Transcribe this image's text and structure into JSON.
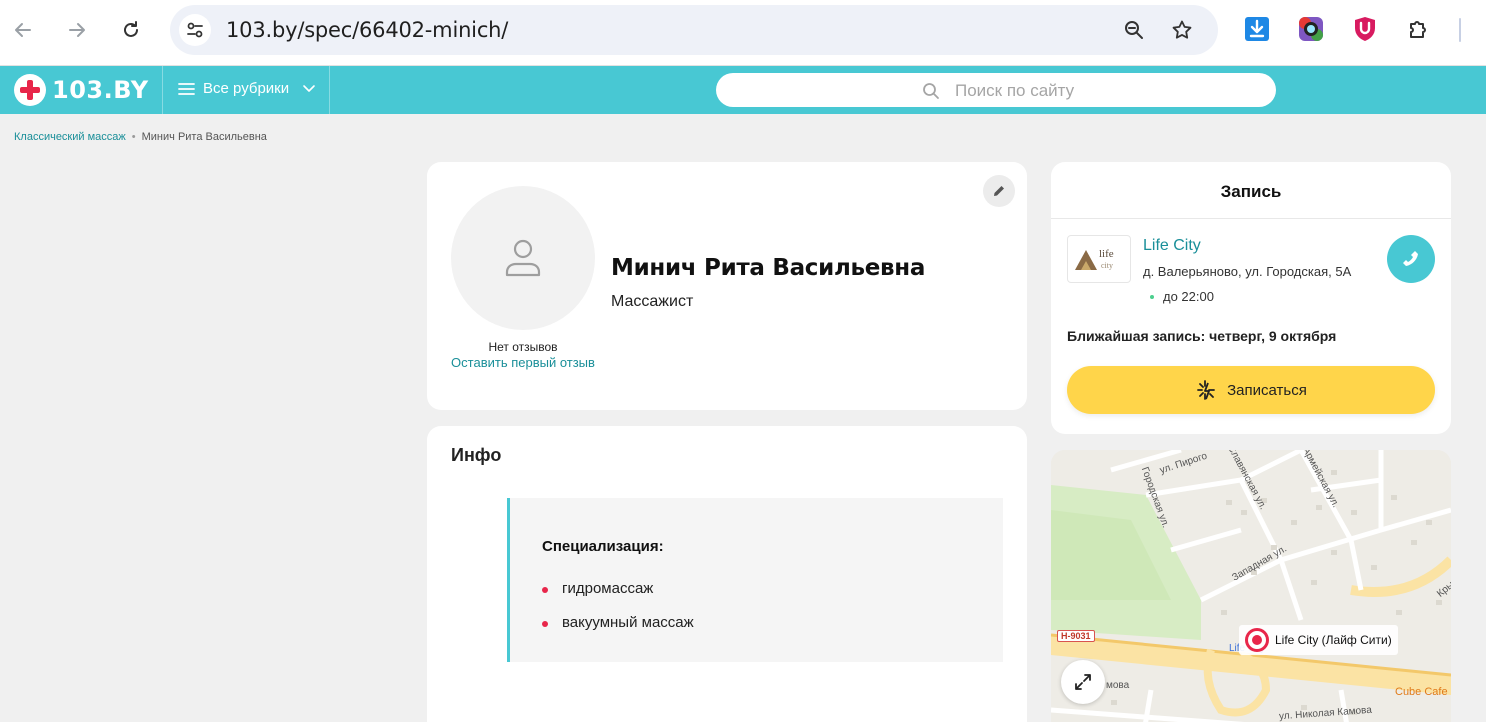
{
  "browser": {
    "url": "103.by/spec/66402-minich/"
  },
  "header": {
    "logo_text": "103.BY",
    "rubrics_label": "Все рубрики",
    "search_placeholder": "Поиск по сайту"
  },
  "breadcrumb": {
    "link": "Классический массаж",
    "separator": "•",
    "current": "Минич Рита Васильевна"
  },
  "profile": {
    "name": "Минич Рита Васильевна",
    "role": "Массажист",
    "no_reviews": "Нет отзывов",
    "first_review_link": "Оставить первый отзыв"
  },
  "info": {
    "title": "Инфо",
    "spec_heading": "Специализация:",
    "spec_items": [
      "гидромассаж",
      "вакуумный массаж"
    ]
  },
  "booking": {
    "title": "Запись",
    "clinic_name": "Life City",
    "clinic_address": "д. Валерьяново, ул. Городская, 5А",
    "clinic_hours": "до 22:00",
    "nearest": "Ближайшая запись: четверг, 9 октября",
    "book_button": "Записаться",
    "logo_text_top": "life",
    "logo_text_bottom": "city"
  },
  "map": {
    "place_label": "Life City (Лайф Сити)",
    "road_code": "Н-9031",
    "cafe_label": "Cube Cafe",
    "streets": {
      "s1": "ул. Пирого",
      "s2": "Славянская ул.",
      "s3": "Армейская ул.",
      "s4": "Городская ул.",
      "s5": "Западная ул.",
      "s6": "ул. Николая Камова",
      "s7": "Life City",
      "s8": "мова",
      "s9": "Крыма"
    }
  },
  "colors": {
    "accent": "#48c8d3",
    "brand_red": "#e8264a",
    "link": "#1a8f99",
    "book_button": "#ffd54a"
  },
  "icons": {
    "back": "arrow-left-icon",
    "forward": "arrow-right-icon",
    "reload": "reload-icon",
    "site_info": "tune-icon",
    "zoom": "zoom-icon",
    "bookmark": "star-icon",
    "download_ext": "download-icon",
    "camera_ext": "camera-icon",
    "shield_ext": "shield-icon",
    "extensions": "puzzle-icon",
    "menu": "hamburger-icon",
    "chevron": "chevron-down-icon",
    "search": "search-icon",
    "avatar": "user-icon",
    "edit": "pencil-icon",
    "phone": "phone-icon",
    "sparkle": "sparkle-icon",
    "expand": "expand-icon",
    "map_pin": "map-pin-icon"
  }
}
